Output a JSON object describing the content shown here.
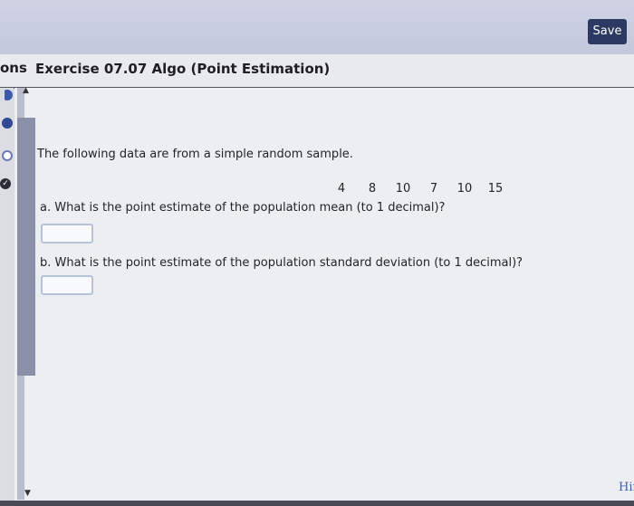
{
  "header": {
    "save_label": "Save"
  },
  "titlebar": {
    "prev_label": "ons",
    "exercise_title": "Exercise 07.07 Algo (Point Estimation)"
  },
  "content": {
    "intro": "The following data are from a simple random sample.",
    "data_values": [
      "4",
      "8",
      "10",
      "7",
      "10",
      "15"
    ],
    "question_a": "a. What is the point estimate of the population mean (to 1 decimal)?",
    "question_b": "b. What is the point estimate of the population standard deviation (to 1 decimal)?",
    "answer_a": "",
    "answer_b": ""
  },
  "footer": {
    "hint_label": "Hir"
  },
  "colors": {
    "save_button": "#2c3a63",
    "accent": "#3b5ba8"
  },
  "icons": {
    "scroll_up": "triangle-up",
    "scroll_down": "triangle-down",
    "status_complete": "checkmark"
  }
}
